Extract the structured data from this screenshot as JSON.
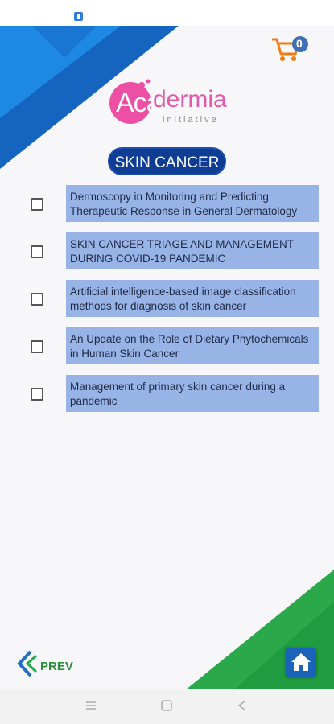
{
  "colors": {
    "brand_blue": "#0f3d94",
    "item_bg": "#98b3e6",
    "logo_pink": "#e35aa8",
    "green": "#2aa84a",
    "home_blue": "#1b63b8"
  },
  "cart": {
    "count": "0"
  },
  "logo": {
    "part1": "Aca",
    "part2": "dermia",
    "sub": "initiative"
  },
  "page_title": "SKIN CANCER",
  "items": [
    {
      "label": "Dermoscopy in Monitoring and Predicting Therapeutic Response in General Dermatology"
    },
    {
      "label": "SKIN CANCER TRIAGE AND MANAGEMENT DURING COVID-19 PANDEMIC"
    },
    {
      "label": "Artificial intelligence-based image classification methods for diagnosis of skin cancer"
    },
    {
      "label": "An Update on the Role of Dietary Phytochemicals in Human Skin Cancer"
    },
    {
      "label": "Management of primary skin cancer during a pandemic"
    }
  ],
  "footer": {
    "prev_label": "PREV"
  },
  "icons": {
    "cart": "cart-icon",
    "home": "home-icon",
    "prev": "chevron-left-icon"
  }
}
